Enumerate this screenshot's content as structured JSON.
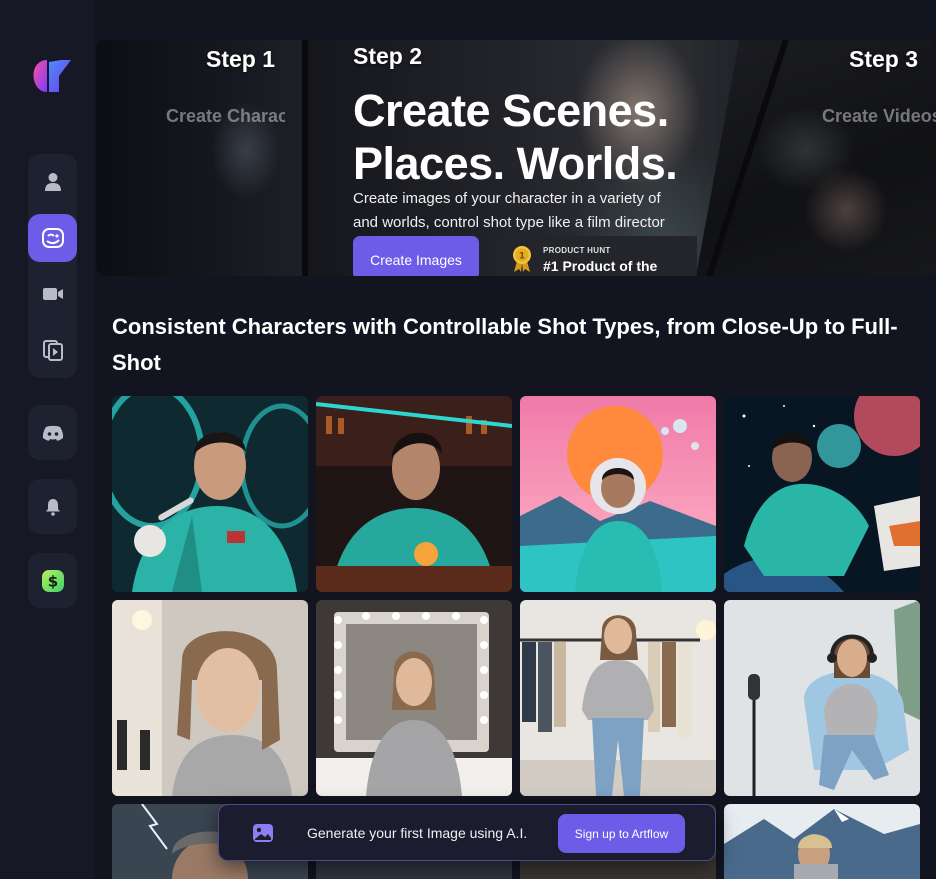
{
  "sidebar": {
    "logo": "artflow-logo",
    "nav_icons": [
      "user-icon",
      "character-face-icon",
      "video-camera-icon",
      "video-library-icon"
    ],
    "active_index": 1,
    "community_icon": "discord-icon",
    "notifications_icon": "bell-icon",
    "billing_icon": "dollar-icon",
    "accent_color": "#6c5ce7"
  },
  "hero": {
    "step1": {
      "label": "Step 1",
      "sub": "Create Charac"
    },
    "step2": {
      "label": "Step 2"
    },
    "step3": {
      "label": "Step 3",
      "sub": "Create Videos"
    },
    "title_line1": "Create Scenes.",
    "title_line2": "Places. Worlds.",
    "desc_line1": "Create images of your character in a variety of",
    "desc_line2": "and worlds, control shot type like a film director",
    "cta_label": "Create Images",
    "badge_kicker": "PRODUCT HUNT",
    "badge_title": "#1 Product of the",
    "badge_medal_number": "1"
  },
  "section": {
    "title": "Consistent Characters with Controllable Shot Types, from Close-Up to Full-Shot"
  },
  "gallery": [
    {
      "subject": "astronaut-brushing-teeth"
    },
    {
      "subject": "astronaut-at-bar"
    },
    {
      "subject": "astronaut-alien-landscape"
    },
    {
      "subject": "astronaut-floating-space"
    },
    {
      "subject": "woman-hoodie-closeup"
    },
    {
      "subject": "woman-vanity-mirror"
    },
    {
      "subject": "woman-clothing-rack"
    },
    {
      "subject": "woman-headphones-chair"
    },
    {
      "subject": "man-lightning-storm"
    },
    {
      "subject": "woman-knight-horse"
    }
  ],
  "toast": {
    "icon": "image-icon",
    "text": "Generate your first Image using A.I.",
    "button_label": "Sign up to Artflow"
  }
}
